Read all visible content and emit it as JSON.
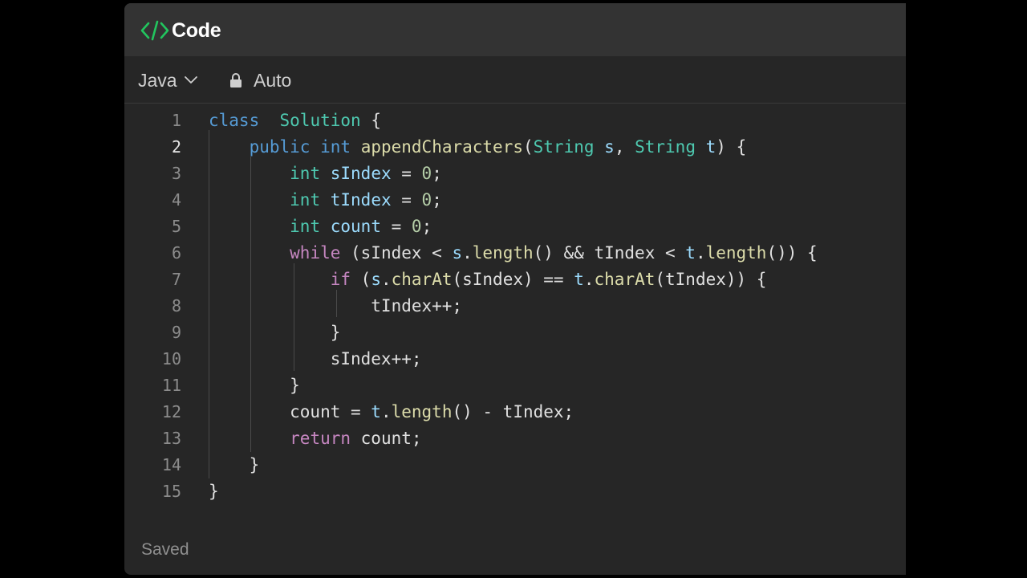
{
  "header": {
    "title": "Code",
    "icon": "code-icon",
    "accent_color": "#22c55e"
  },
  "toolbar": {
    "language": "Java",
    "language_icon": "chevron-down-icon",
    "mode": "Auto",
    "mode_icon": "lock-icon"
  },
  "editor": {
    "active_line": 2,
    "lines": [
      {
        "n": "1",
        "tokens": [
          [
            "kw",
            "class"
          ],
          [
            "",
            "  "
          ],
          [
            "ty",
            "Solution"
          ],
          [
            "",
            " {"
          ]
        ]
      },
      {
        "n": "2",
        "tokens": [
          [
            "",
            "    "
          ],
          [
            "kw",
            "public"
          ],
          [
            "",
            " "
          ],
          [
            "kw",
            "int"
          ],
          [
            "",
            " "
          ],
          [
            "fn",
            "appendCharacters"
          ],
          [
            "",
            "("
          ],
          [
            "ty",
            "String"
          ],
          [
            "",
            " "
          ],
          [
            "var",
            "s"
          ],
          [
            "",
            ", "
          ],
          [
            "ty",
            "String"
          ],
          [
            "",
            " "
          ],
          [
            "var",
            "t"
          ],
          [
            "",
            ") {"
          ]
        ]
      },
      {
        "n": "3",
        "tokens": [
          [
            "",
            "        "
          ],
          [
            "ty",
            "int"
          ],
          [
            "",
            " "
          ],
          [
            "var",
            "sIndex"
          ],
          [
            "",
            " = "
          ],
          [
            "num",
            "0"
          ],
          [
            "",
            ";"
          ]
        ]
      },
      {
        "n": "4",
        "tokens": [
          [
            "",
            "        "
          ],
          [
            "ty",
            "int"
          ],
          [
            "",
            " "
          ],
          [
            "var",
            "tIndex"
          ],
          [
            "",
            " = "
          ],
          [
            "num",
            "0"
          ],
          [
            "",
            ";"
          ]
        ]
      },
      {
        "n": "5",
        "tokens": [
          [
            "",
            "        "
          ],
          [
            "ty",
            "int"
          ],
          [
            "",
            " "
          ],
          [
            "var",
            "count"
          ],
          [
            "",
            " = "
          ],
          [
            "num",
            "0"
          ],
          [
            "",
            ";"
          ]
        ]
      },
      {
        "n": "6",
        "tokens": [
          [
            "",
            "        "
          ],
          [
            "ctl",
            "while"
          ],
          [
            "",
            " (sIndex < "
          ],
          [
            "var",
            "s"
          ],
          [
            "",
            "."
          ],
          [
            "fn",
            "length"
          ],
          [
            "",
            "() && tIndex < "
          ],
          [
            "var",
            "t"
          ],
          [
            "",
            "."
          ],
          [
            "fn",
            "length"
          ],
          [
            "",
            "()) {"
          ]
        ]
      },
      {
        "n": "7",
        "tokens": [
          [
            "",
            "            "
          ],
          [
            "ctl",
            "if"
          ],
          [
            "",
            " ("
          ],
          [
            "var",
            "s"
          ],
          [
            "",
            "."
          ],
          [
            "fn",
            "charAt"
          ],
          [
            "",
            "(sIndex) == "
          ],
          [
            "var",
            "t"
          ],
          [
            "",
            "."
          ],
          [
            "fn",
            "charAt"
          ],
          [
            "",
            "(tIndex)) {"
          ]
        ]
      },
      {
        "n": "8",
        "tokens": [
          [
            "",
            "                tIndex++;"
          ]
        ]
      },
      {
        "n": "9",
        "tokens": [
          [
            "",
            "            }"
          ]
        ]
      },
      {
        "n": "10",
        "tokens": [
          [
            "",
            "            sIndex++;"
          ]
        ]
      },
      {
        "n": "11",
        "tokens": [
          [
            "",
            "        }"
          ]
        ]
      },
      {
        "n": "12",
        "tokens": [
          [
            "",
            "        count = "
          ],
          [
            "var",
            "t"
          ],
          [
            "",
            "."
          ],
          [
            "fn",
            "length"
          ],
          [
            "",
            "() - tIndex;"
          ]
        ]
      },
      {
        "n": "13",
        "tokens": [
          [
            "",
            "        "
          ],
          [
            "ctl",
            "return"
          ],
          [
            "",
            " count;"
          ]
        ]
      },
      {
        "n": "14",
        "tokens": [
          [
            "",
            "    }"
          ]
        ]
      },
      {
        "n": "15",
        "tokens": [
          [
            "",
            "}"
          ]
        ]
      }
    ]
  },
  "status": {
    "text": "Saved"
  }
}
